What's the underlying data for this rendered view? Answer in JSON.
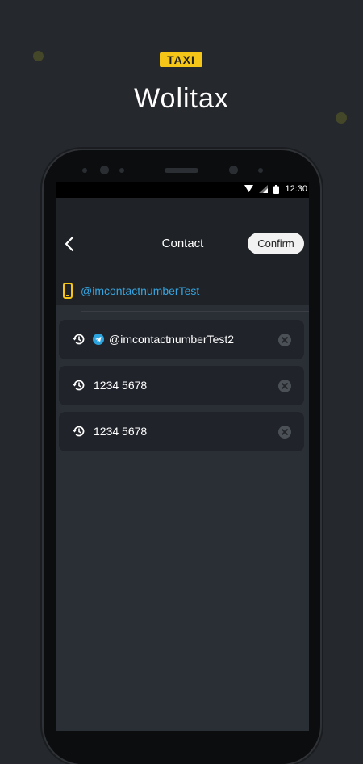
{
  "brand": {
    "badge": "TAXI",
    "app_name": "Wolitax",
    "accent_color": "#f5c518"
  },
  "status_bar": {
    "time": "12:30"
  },
  "header": {
    "title": "Contact",
    "confirm_label": "Confirm"
  },
  "contact": {
    "value": "@imcontactnumberTest",
    "icon": "phone-icon",
    "value_color": "#35a4e0"
  },
  "history": [
    {
      "text": "@imcontactnumberTest2",
      "type": "telegram"
    },
    {
      "text": "1234 5678",
      "type": "phone"
    },
    {
      "text": "1234 5678",
      "type": "phone"
    }
  ]
}
